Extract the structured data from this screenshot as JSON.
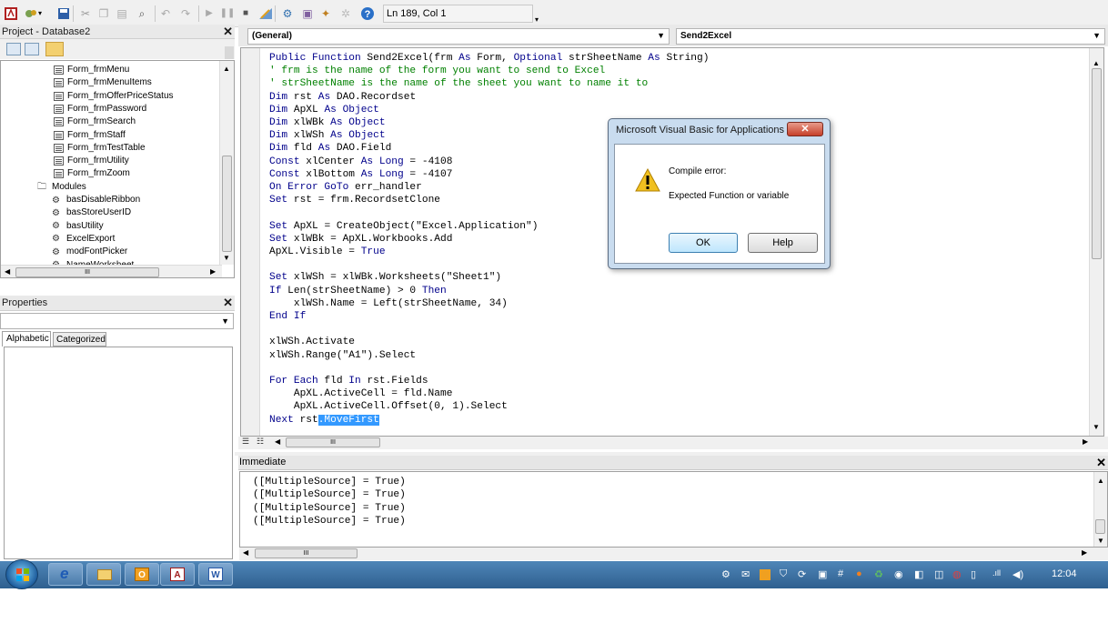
{
  "toolbar": {
    "cursor_position": "Ln 189, Col 1",
    "icons": [
      "access-icon",
      "tools-icon",
      "save-icon",
      "cut-icon",
      "copy-icon",
      "paste-icon",
      "find-icon",
      "undo-icon",
      "redo-icon",
      "run-icon",
      "break-icon",
      "reset-icon",
      "design-mode-icon",
      "project-explorer-icon",
      "properties-icon",
      "object-browser-icon",
      "toolbox-icon",
      "help-icon"
    ]
  },
  "project_panel": {
    "title": "Project - Database2",
    "items": [
      {
        "label": "Form_frmMenu",
        "type": "form"
      },
      {
        "label": "Form_frmMenuItems",
        "type": "form"
      },
      {
        "label": "Form_frmOfferPriceStatus",
        "type": "form"
      },
      {
        "label": "Form_frmPassword",
        "type": "form"
      },
      {
        "label": "Form_frmSearch",
        "type": "form"
      },
      {
        "label": "Form_frmStaff",
        "type": "form"
      },
      {
        "label": "Form_frmTestTable",
        "type": "form"
      },
      {
        "label": "Form_frmUtility",
        "type": "form"
      },
      {
        "label": "Form_frmZoom",
        "type": "form"
      },
      {
        "label": "Modules",
        "type": "folder"
      },
      {
        "label": "basDisableRibbon",
        "type": "module"
      },
      {
        "label": "basStoreUserID",
        "type": "module"
      },
      {
        "label": "basUtility",
        "type": "module"
      },
      {
        "label": "ExcelExport",
        "type": "module"
      },
      {
        "label": "modFontPicker",
        "type": "module"
      },
      {
        "label": "NameWorksheet",
        "type": "module"
      }
    ],
    "scroll_label": "III"
  },
  "properties_panel": {
    "title": "Properties",
    "tabs": [
      "Alphabetic",
      "Categorized"
    ],
    "active_tab": "Alphabetic"
  },
  "code_window": {
    "object_dropdown": "(General)",
    "procedure_dropdown": "Send2Excel",
    "hscroll_label": "III",
    "lines": [
      [
        [
          "kw",
          "Public Function "
        ],
        [
          "t",
          "Send2Excel(frm "
        ],
        [
          "kw",
          "As"
        ],
        [
          "t",
          " Form, "
        ],
        [
          "kw",
          "Optional"
        ],
        [
          "t",
          " strSheetName "
        ],
        [
          "kw",
          "As"
        ],
        [
          "t",
          " String)"
        ]
      ],
      [
        [
          "cm",
          "' frm is the name of the form you want to send to Excel"
        ]
      ],
      [
        [
          "cm",
          "' strSheetName is the name of the sheet you want to name it to"
        ]
      ],
      [
        [
          "kw",
          "Dim"
        ],
        [
          "t",
          " rst "
        ],
        [
          "kw",
          "As"
        ],
        [
          "t",
          " DAO.Recordset"
        ]
      ],
      [
        [
          "kw",
          "Dim"
        ],
        [
          "t",
          " ApXL "
        ],
        [
          "kw",
          "As Object"
        ]
      ],
      [
        [
          "kw",
          "Dim"
        ],
        [
          "t",
          " xlWBk "
        ],
        [
          "kw",
          "As Object"
        ]
      ],
      [
        [
          "kw",
          "Dim"
        ],
        [
          "t",
          " xlWSh "
        ],
        [
          "kw",
          "As Object"
        ]
      ],
      [
        [
          "kw",
          "Dim"
        ],
        [
          "t",
          " fld "
        ],
        [
          "kw",
          "As"
        ],
        [
          "t",
          " DAO.Field"
        ]
      ],
      [
        [
          "kw",
          "Const"
        ],
        [
          "t",
          " xlCenter "
        ],
        [
          "kw",
          "As Long"
        ],
        [
          "t",
          " = -4108"
        ]
      ],
      [
        [
          "kw",
          "Const"
        ],
        [
          "t",
          " xlBottom "
        ],
        [
          "kw",
          "As Long"
        ],
        [
          "t",
          " = -4107"
        ]
      ],
      [
        [
          "kw",
          "On Error GoTo"
        ],
        [
          "t",
          " err_handler"
        ]
      ],
      [
        [
          "kw",
          "Set"
        ],
        [
          "t",
          " rst = frm.RecordsetClone"
        ]
      ],
      [],
      [
        [
          "kw",
          "Set"
        ],
        [
          "t",
          " ApXL = CreateObject(\"Excel.Application\")"
        ]
      ],
      [
        [
          "kw",
          "Set"
        ],
        [
          "t",
          " xlWBk = ApXL.Workbooks.Add"
        ]
      ],
      [
        [
          "t",
          "ApXL.Visible = "
        ],
        [
          "kw",
          "True"
        ]
      ],
      [],
      [
        [
          "kw",
          "Set"
        ],
        [
          "t",
          " xlWSh = xlWBk.Worksheets(\"Sheet1\")"
        ]
      ],
      [
        [
          "kw",
          "If"
        ],
        [
          "t",
          " Len(strSheetName) > 0 "
        ],
        [
          "kw",
          "Then"
        ]
      ],
      [
        [
          "t",
          "    xlWSh.Name = Left(strSheetName, 34)"
        ]
      ],
      [
        [
          "kw",
          "End If"
        ]
      ],
      [],
      [
        [
          "t",
          "xlWSh.Activate"
        ]
      ],
      [
        [
          "t",
          "xlWSh.Range(\"A1\").Select"
        ]
      ],
      [],
      [
        [
          "kw",
          "For Each"
        ],
        [
          "t",
          " fld "
        ],
        [
          "kw",
          "In"
        ],
        [
          "t",
          " rst.Fields"
        ]
      ],
      [
        [
          "t",
          "    ApXL.ActiveCell = fld.Name"
        ]
      ],
      [
        [
          "t",
          "    ApXL.ActiveCell.Offset(0, 1).Select"
        ]
      ],
      [
        [
          "kw",
          "Next"
        ],
        [
          "t",
          " rst"
        ],
        [
          "sel",
          ".MoveFirst"
        ]
      ]
    ]
  },
  "dialog": {
    "title": "Microsoft Visual Basic for Applications",
    "message_title": "Compile error:",
    "message_body": "Expected Function or variable",
    "ok_label": "OK",
    "help_label": "Help",
    "icon": "warning-icon"
  },
  "immediate": {
    "title": "Immediate",
    "lines": [
      "([MultipleSource] = True)",
      "([MultipleSource] = True)",
      "([MultipleSource] = True)",
      "([MultipleSource] = True)"
    ],
    "hscroll_label": "III"
  },
  "taskbar": {
    "apps": [
      {
        "name": "start-orb",
        "label": ""
      },
      {
        "name": "internet-explorer",
        "label": "e"
      },
      {
        "name": "file-explorer",
        "label": ""
      },
      {
        "name": "outlook",
        "label": "O"
      },
      {
        "name": "access",
        "label": "A"
      },
      {
        "name": "word",
        "label": "W"
      }
    ],
    "clock": "12:04"
  },
  "colors": {
    "keyword": "#00008b",
    "comment": "#008000",
    "selection": "#3399ff",
    "taskbar": "#2e5f8f"
  }
}
